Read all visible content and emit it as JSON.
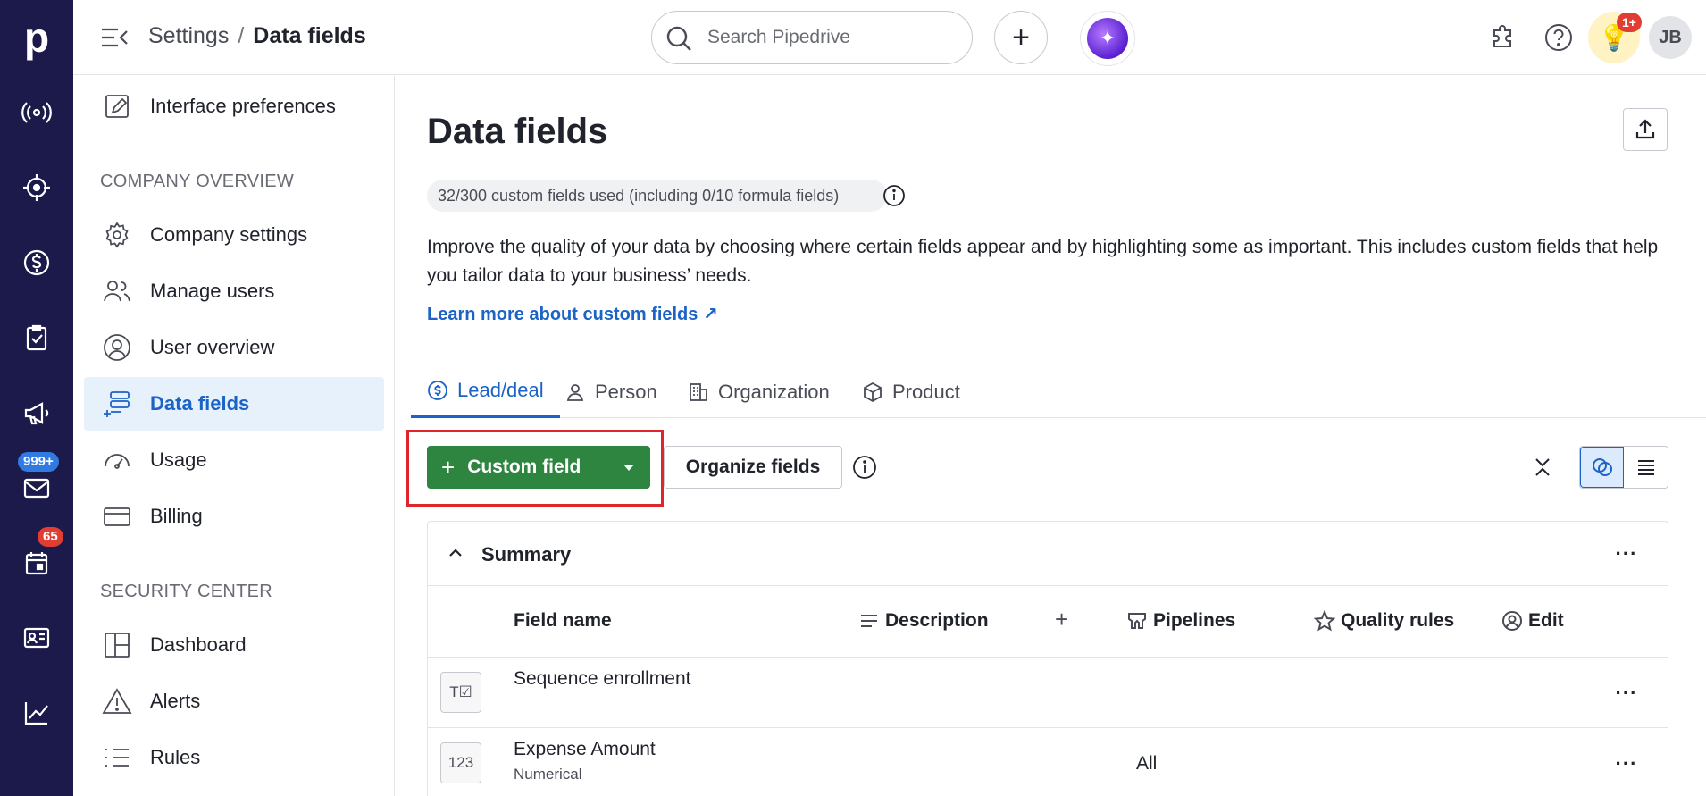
{
  "rail": {
    "logo": "p",
    "badges": {
      "mail": "999+",
      "calendar": "65"
    }
  },
  "header": {
    "breadcrumb": {
      "parent": "Settings",
      "separator": "/",
      "current": "Data fields"
    },
    "search_placeholder": "Search Pipedrive",
    "add_label": "+",
    "tips_badge": "1+",
    "avatar_initials": "JB"
  },
  "sidebar": {
    "top_item": "Interface preferences",
    "section_company": "COMPANY OVERVIEW",
    "company_items": [
      "Company settings",
      "Manage users",
      "User overview",
      "Data fields",
      "Usage",
      "Billing"
    ],
    "section_security": "SECURITY CENTER",
    "security_items": [
      "Dashboard",
      "Alerts",
      "Rules"
    ]
  },
  "main": {
    "title": "Data fields",
    "usage": "32/300 custom fields used (including 0/10 formula fields)",
    "description": "Improve the quality of your data by choosing where certain fields appear and by highlighting some as important. This includes custom fields that help you tailor data to your business’ needs.",
    "learn_more": "Learn more about custom fields ↗",
    "tabs": [
      "Lead/deal",
      "Person",
      "Organization",
      "Product"
    ],
    "custom_field_label": "Custom field",
    "organize_label": "Organize fields",
    "panel_title": "Summary",
    "columns": {
      "field_name": "Field name",
      "description": "Description",
      "add": "+",
      "pipelines": "Pipelines",
      "quality": "Quality rules",
      "edit": "Edit"
    },
    "rows": [
      {
        "name": "Sequence enrollment",
        "sub": "",
        "pipelines": "",
        "icon_text": "T☑"
      },
      {
        "name": "Expense Amount",
        "sub": "Numerical",
        "pipelines": "All",
        "icon_text": "123"
      }
    ],
    "more": "···"
  }
}
